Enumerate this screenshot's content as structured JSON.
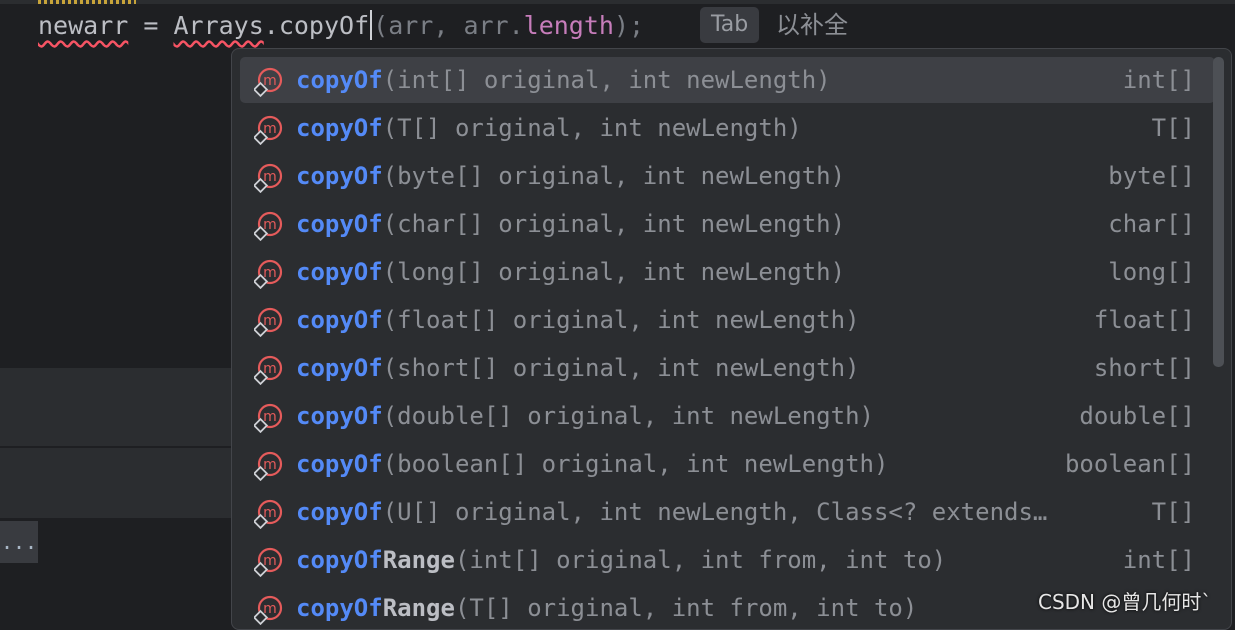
{
  "editor": {
    "code_var": "newarr",
    "code_eq": " = ",
    "code_class": "Arrays",
    "code_method": ".copyOf",
    "code_hint_a": "(arr, arr.",
    "code_hint_field": "length",
    "code_hint_b": ");",
    "tab_key": "Tab",
    "tab_hint": "以补全",
    "ellipsis": "..."
  },
  "completion": {
    "items": [
      {
        "name": "copyOf",
        "name_rest": "",
        "signature": "(int[] original, int newLength)",
        "type": "int[]"
      },
      {
        "name": "copyOf",
        "name_rest": "",
        "signature": "(T[] original, int newLength)",
        "type": "T[]"
      },
      {
        "name": "copyOf",
        "name_rest": "",
        "signature": "(byte[] original, int newLength)",
        "type": "byte[]"
      },
      {
        "name": "copyOf",
        "name_rest": "",
        "signature": "(char[] original, int newLength)",
        "type": "char[]"
      },
      {
        "name": "copyOf",
        "name_rest": "",
        "signature": "(long[] original, int newLength)",
        "type": "long[]"
      },
      {
        "name": "copyOf",
        "name_rest": "",
        "signature": "(float[] original, int newLength)",
        "type": "float[]"
      },
      {
        "name": "copyOf",
        "name_rest": "",
        "signature": "(short[] original, int newLength)",
        "type": "short[]"
      },
      {
        "name": "copyOf",
        "name_rest": "",
        "signature": "(double[] original, int newLength)",
        "type": "double[]"
      },
      {
        "name": "copyOf",
        "name_rest": "",
        "signature": "(boolean[] original, int newLength)",
        "type": "boolean[]"
      },
      {
        "name": "copyOf",
        "name_rest": "",
        "signature": "(U[] original, int newLength, Class<? extends…",
        "type": "T[]"
      },
      {
        "name": "copyOf",
        "name_rest": "Range",
        "signature": "(int[] original, int from, int to)",
        "type": "int[]"
      },
      {
        "name": "copyOf",
        "name_rest": "Range",
        "signature": "(T[] original, int from, int to)",
        "type": ""
      }
    ],
    "selected_index": 0,
    "icon": "method-icon",
    "icon_color": "#e55b5b"
  },
  "watermark": "CSDN @曾几何时`"
}
